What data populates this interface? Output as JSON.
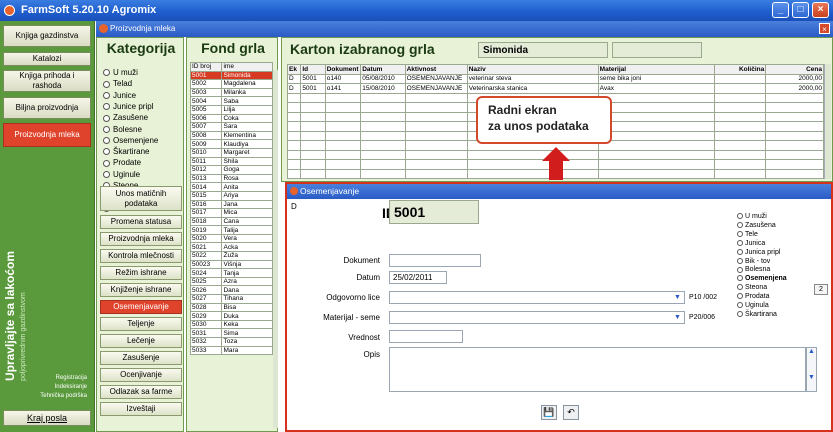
{
  "app": {
    "title": "FarmSoft 5.20.10 Agromix",
    "window_buttons": [
      "_",
      "□",
      "×"
    ]
  },
  "subwindow": {
    "title": "Proizvodnja mleka"
  },
  "leftnav": {
    "items": [
      "Knjiga gazdinstva",
      "Katalozi",
      "Knjiga prihoda i rashoda",
      "Biljna proizvodnja",
      "Proizvodnja mleka"
    ],
    "vertical_title": "Upravljajte sa lakoćom",
    "vertical_subtitle": "poljoprivrednim gazdinstvom",
    "small_links": [
      "Registracija",
      "Indeksiranje",
      "Tehnička podrška"
    ],
    "kraj": "Kraj posla"
  },
  "kategorija": {
    "title": "Kategorija",
    "options": [
      "U muži",
      "Telad",
      "Junice",
      "Junice pripl",
      "Zasušene",
      "Bolesne",
      "Osemenjene",
      "Škartirane",
      "Prodate",
      "Uginule",
      "Steone",
      "Bikovi",
      "S v e  n a  farmi"
    ],
    "selected_index": 12,
    "actions": [
      "Unos matičnih podataka",
      "Promena statusa",
      "Proizvodnja mleka",
      "Kontrola mlečnosti",
      "Režim ishrane",
      "Knjiženje ishrane",
      "Osemenjavanje",
      "Teljenje",
      "Lečenje",
      "Zasušenje",
      "Ocenjivanje",
      "Odlazak sa farme",
      "Izveštaji"
    ],
    "active_action_index": 6
  },
  "fond": {
    "title": "Fond grla",
    "columns": [
      "ID broj",
      "ime"
    ],
    "rows": [
      [
        "5001",
        "Simonida"
      ],
      [
        "5002",
        "Magdalena"
      ],
      [
        "5003",
        "Milanka"
      ],
      [
        "5004",
        "Saba"
      ],
      [
        "5005",
        "Lilja"
      ],
      [
        "5006",
        "Coka"
      ],
      [
        "5007",
        "Sara"
      ],
      [
        "5008",
        "Klementina"
      ],
      [
        "5009",
        "Klaudiya"
      ],
      [
        "5010",
        "Margaret"
      ],
      [
        "5011",
        "Shila"
      ],
      [
        "5012",
        "Goga"
      ],
      [
        "5013",
        "Rosa"
      ],
      [
        "5014",
        "Anita"
      ],
      [
        "5015",
        "Ariya"
      ],
      [
        "5016",
        "Jana"
      ],
      [
        "5017",
        "Mica"
      ],
      [
        "5018",
        "Cana"
      ],
      [
        "5019",
        "Talija"
      ],
      [
        "5020",
        "Vera"
      ],
      [
        "5021",
        "Acka"
      ],
      [
        "5022",
        "Žuža"
      ],
      [
        "50023",
        "Višnja"
      ],
      [
        "5024",
        "Tanja"
      ],
      [
        "5025",
        "Azra"
      ],
      [
        "5026",
        "Dana"
      ],
      [
        "5027",
        "Tihana"
      ],
      [
        "5028",
        "Bisa"
      ],
      [
        "5029",
        "Duka"
      ],
      [
        "5030",
        "Keka"
      ],
      [
        "5031",
        "Sima"
      ],
      [
        "5032",
        "Toza"
      ],
      [
        "5033",
        "Mara"
      ]
    ],
    "selected_index": 0
  },
  "karton": {
    "title": "Karton izabranog grla",
    "selected_name": "Simonida",
    "columns": [
      "Ek",
      "Id",
      "Dokument",
      "Datum",
      "Aktivnost",
      "Naziv",
      "Materijal",
      "Količina",
      "Cena"
    ],
    "rows": [
      [
        "D",
        "5001",
        "o140",
        "05/08/2010",
        "OSEMENJAVANJE",
        "veterinar steva",
        "seme bika joni",
        "",
        "2000,00"
      ],
      [
        "D",
        "5001",
        "o141",
        "15/08/2010",
        "OSEMENJAVANJE",
        "Veterinarska stanica",
        "Avax",
        "",
        "2000,00"
      ]
    ],
    "empty_rows": 9
  },
  "callout": {
    "line1": "Radni ekran",
    "line2": "za unos podataka"
  },
  "dialog": {
    "title": "Osemenjavanje",
    "tab": "D",
    "id_label": "ID",
    "id_value": "5001",
    "dokument_label": "Dokument",
    "dokument_value": "",
    "datum_label": "Datum",
    "datum_value": "25/02/2011",
    "odgovorno_label": "Odgovorno lice",
    "odgovorno_code": "P10 /002",
    "materijal_label": "Materijal - seme",
    "materijal_code": "P20/006",
    "vrednost_label": "Vrednost",
    "opis_label": "Opis",
    "status_options": [
      "U muži",
      "Zasušena",
      "Tele",
      "Junica",
      "Junica pripl",
      "Bik - tov",
      "Bolesna",
      "Osemenjena",
      "Steona",
      "Prodata",
      "Uginula",
      "Škartirana"
    ],
    "osemenjena_count": "2"
  },
  "colors": {
    "accent_red": "#d63a23",
    "nav_green": "#5a9a3c",
    "panel_green": "#e8f2d6",
    "title_blue": "#2a5bc6"
  }
}
